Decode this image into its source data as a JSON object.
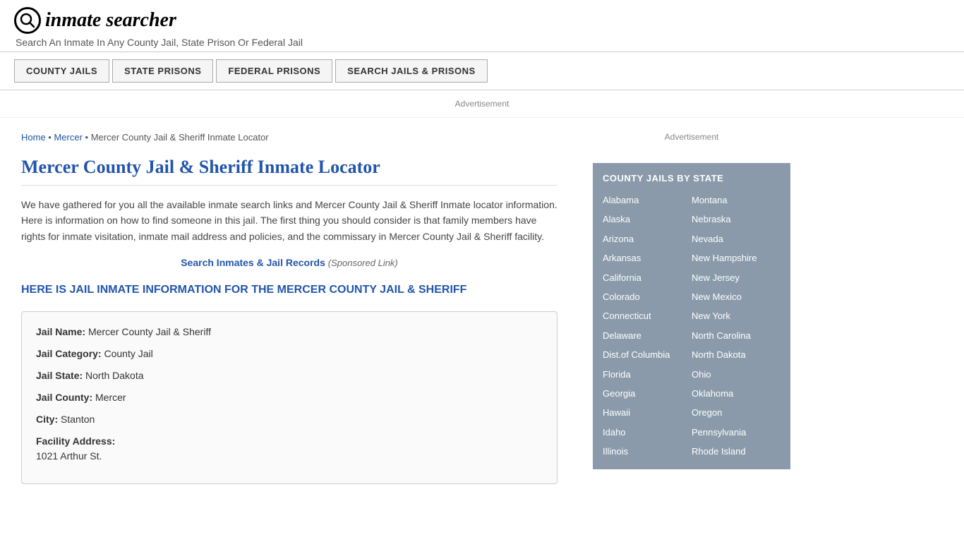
{
  "header": {
    "logo_icon": "🔍",
    "logo_text": "inmate searcher",
    "tagline": "Search An Inmate In Any County Jail, State Prison Or Federal Jail"
  },
  "nav": {
    "buttons": [
      {
        "label": "COUNTY JAILS",
        "name": "county-jails-nav"
      },
      {
        "label": "STATE PRISONS",
        "name": "state-prisons-nav"
      },
      {
        "label": "FEDERAL PRISONS",
        "name": "federal-prisons-nav"
      },
      {
        "label": "SEARCH JAILS & PRISONS",
        "name": "search-jails-nav"
      }
    ]
  },
  "ad_banner": "Advertisement",
  "breadcrumb": {
    "home": "Home",
    "separator1": " • ",
    "mercer": "Mercer",
    "separator2": " • ",
    "current": "Mercer County Jail & Sheriff Inmate Locator"
  },
  "page_title": "Mercer County Jail & Sheriff Inmate Locator",
  "description": "We have gathered for you all the available inmate search links and Mercer County Jail & Sheriff Inmate locator information. Here is information on how to find someone in this jail. The first thing you should consider is that family members have rights for inmate visitation, inmate mail address and policies, and the commissary in Mercer County Jail & Sheriff facility.",
  "search_link": {
    "text": "Search Inmates & Jail Records",
    "sponsored": "(Sponsored Link)"
  },
  "section_heading": "HERE IS JAIL INMATE INFORMATION FOR THE MERCER COUNTY JAIL & SHERIFF",
  "info_box": {
    "jail_name_label": "Jail Name:",
    "jail_name_value": "Mercer County Jail & Sheriff",
    "jail_category_label": "Jail Category:",
    "jail_category_value": "County Jail",
    "jail_state_label": "Jail State:",
    "jail_state_value": "North Dakota",
    "jail_county_label": "Jail County:",
    "jail_county_value": "Mercer",
    "city_label": "City:",
    "city_value": "Stanton",
    "facility_address_label": "Facility Address:",
    "facility_address_value": "1021 Arthur St."
  },
  "sidebar": {
    "ad_text": "Advertisement",
    "state_box": {
      "title": "COUNTY JAILS BY STATE",
      "left_column": [
        "Alabama",
        "Alaska",
        "Arizona",
        "Arkansas",
        "California",
        "Colorado",
        "Connecticut",
        "Delaware",
        "Dist.of Columbia",
        "Florida",
        "Georgia",
        "Hawaii",
        "Idaho",
        "Illinois"
      ],
      "right_column": [
        "Montana",
        "Nebraska",
        "Nevada",
        "New Hampshire",
        "New Jersey",
        "New Mexico",
        "New York",
        "North Carolina",
        "North Dakota",
        "Ohio",
        "Oklahoma",
        "Oregon",
        "Pennsylvania",
        "Rhode Island"
      ]
    }
  }
}
